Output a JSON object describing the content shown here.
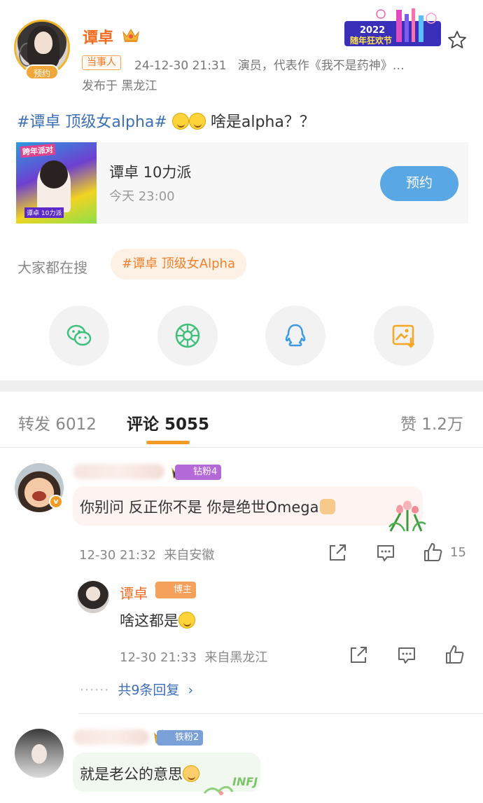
{
  "post": {
    "author_name": "谭卓",
    "avatar_badge": "预约",
    "role_tag": "当事人",
    "datetime": "24-12-30 21:31",
    "bio": "演员，代表作《我不是药神》…",
    "location": "发布于 黑龙江",
    "hashtag": "#谭卓 顶级女alpha#",
    "text_after": " 啥是alpha？？",
    "banner_year": "2022",
    "banner_text": "随年狂欢节"
  },
  "live_card": {
    "title": "谭卓 10力派",
    "time": "今天 23:00",
    "button_label": "预约",
    "thumb_top": "跨年派对",
    "thumb_label": "谭卓 10力派"
  },
  "search": {
    "label": "大家都在搜",
    "chip": "#谭卓 顶级女Alpha"
  },
  "share": {
    "icons": [
      "wechat-icon",
      "moments-icon",
      "qq-icon",
      "save-image-icon"
    ],
    "colors": {
      "wechat": "#3fc07a",
      "moments": "#3fc07a",
      "qq": "#3a9be0",
      "save": "#f5a623"
    }
  },
  "tabs": {
    "repost": "转发 6012",
    "comment": "评论 5055",
    "like": "赞 1.2万"
  },
  "comments": [
    {
      "fan_badge": "钻粉4",
      "text": "你别问 反正你不是 你是绝世Omega",
      "time": "12-30 21:32",
      "source": "来自安徽",
      "likes": "15",
      "reply": {
        "name": "谭卓",
        "badge": "博主",
        "text": "啥这都是",
        "time": "12-30 21:33",
        "source": "来自黑龙江"
      },
      "more_replies": "共9条回复"
    },
    {
      "fan_badge": "铁粉2",
      "text": "就是老公的意思",
      "sticker_text": "INFJ"
    }
  ],
  "colors": {
    "accent_orange": "#f26b1f",
    "link_blue": "#3d6fb6",
    "button_blue": "#5aa7e6",
    "underline": "#f59a23"
  }
}
